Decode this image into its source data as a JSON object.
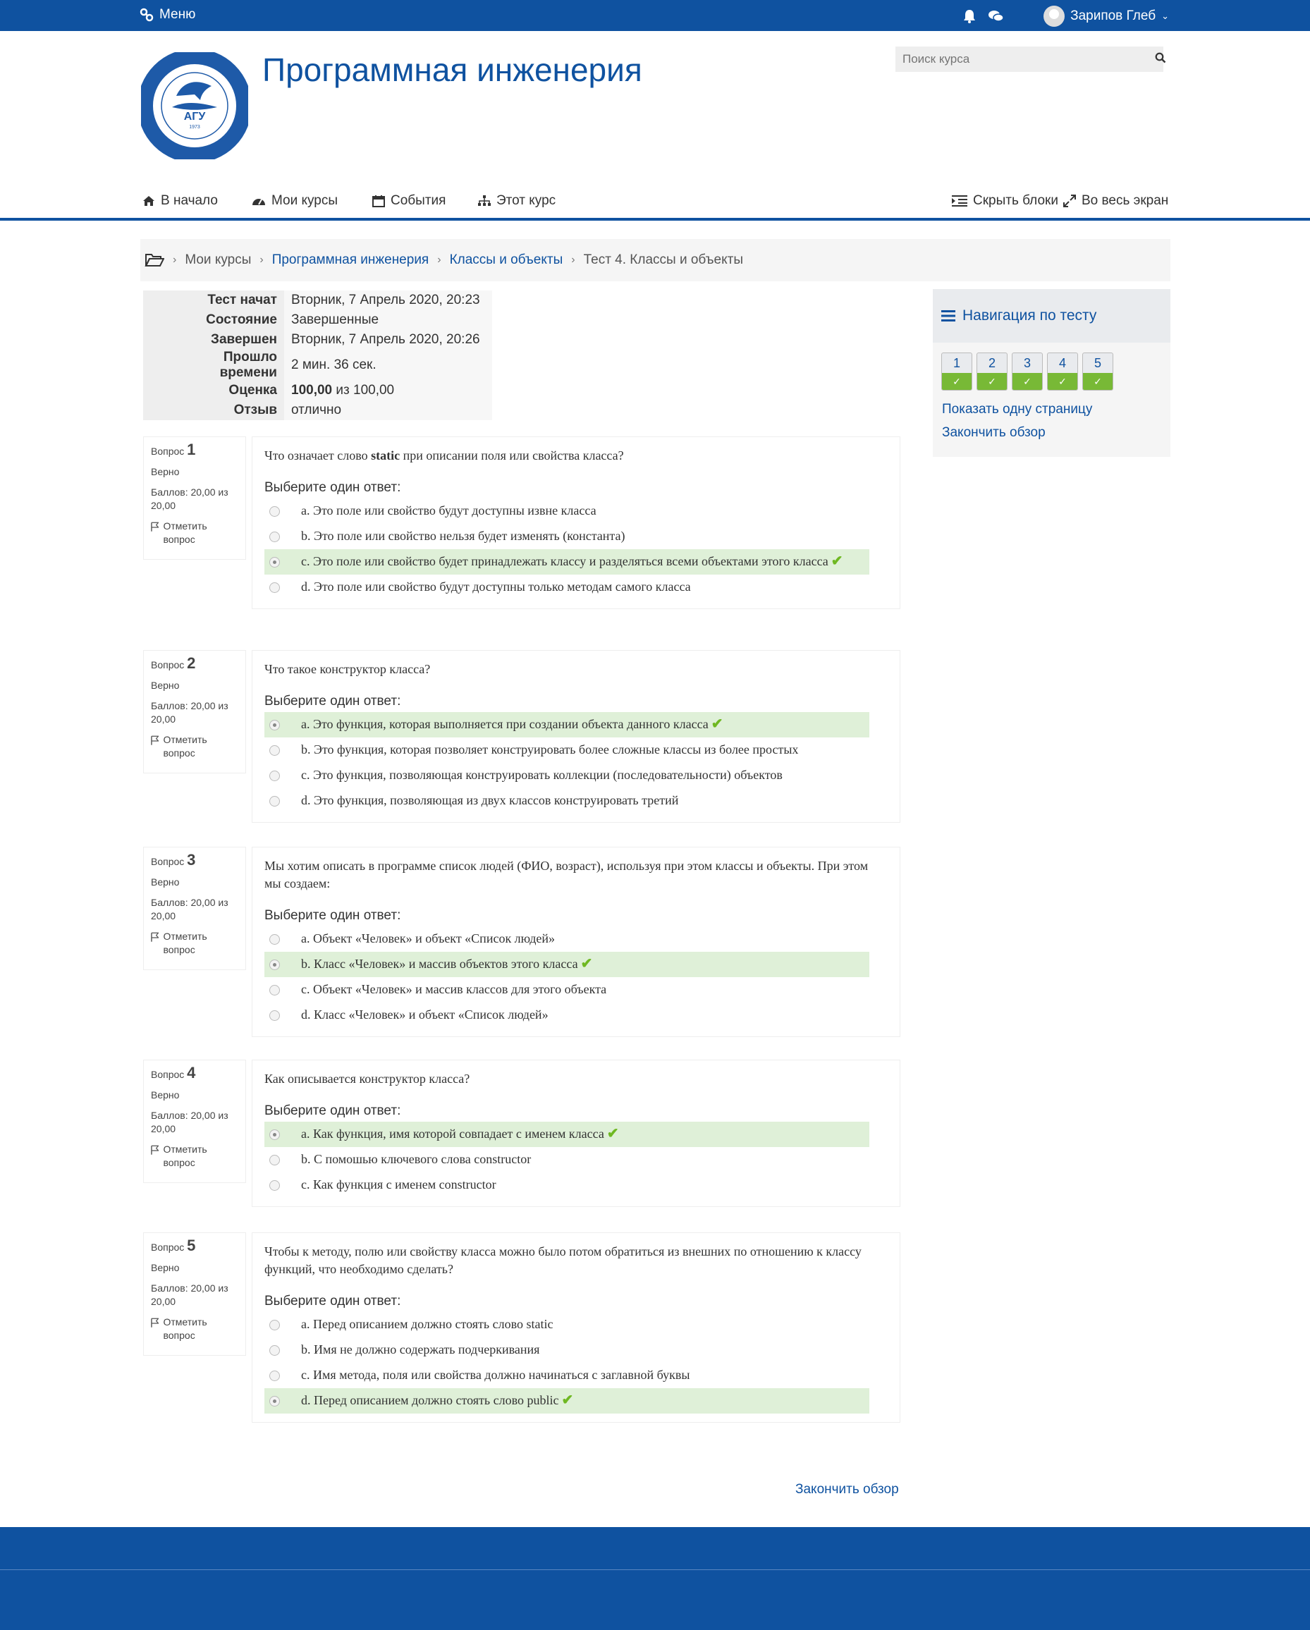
{
  "topbar": {
    "menu_label": "Меню",
    "user_name": "Зарипов Глеб"
  },
  "header": {
    "site_title": "Программная инженерия",
    "search_placeholder": "Поиск курса",
    "logo_text": [
      "АЛТАЙСКИЙ ГОСУДАРСТВЕННЫЙ УНИВЕРСИТЕТ",
      "АГУ",
      "1973"
    ]
  },
  "nav": {
    "home": "В начало",
    "my_courses": "Мои курсы",
    "events": "События",
    "this_course": "Этот курс",
    "hide_blocks": "Скрыть блоки",
    "fullscreen": "Во весь экран"
  },
  "breadcrumb": [
    "Мои курсы",
    "Программная инженерия",
    "Классы и объекты",
    "Тест 4. Классы и объекты"
  ],
  "summary": [
    {
      "label": "Тест начат",
      "value": "Вторник, 7 Апрель 2020, 20:23"
    },
    {
      "label": "Состояние",
      "value": "Завершенные"
    },
    {
      "label": "Завершен",
      "value": "Вторник, 7 Апрель 2020, 20:26"
    },
    {
      "label": "Прошло времени",
      "value": "2 мин. 36 сек."
    },
    {
      "label": "Оценка",
      "value_bold": "100,00",
      "value": " из 100,00"
    },
    {
      "label": "Отзыв",
      "value": "отлично"
    }
  ],
  "question_labels": {
    "question": "Вопрос",
    "status": "Верно",
    "score": "Баллов: 20,00 из 20,00",
    "flag": "Отметить вопрос",
    "prompt": "Выберите один ответ:"
  },
  "questions": [
    {
      "number": "1",
      "text_before": "Что означает слово ",
      "text_bold": "static",
      "text_after": " при описании поля или свойства класса?",
      "answers": [
        "a. Это поле или свойство будут доступны извне класса",
        "b. Это поле или свойство нельзя будет изменять (константа)",
        "c. Это поле или свойство будет принадлежать классу и разделяться всеми объектами этого класса",
        "d. Это поле или свойство будут доступны только методам самого класса"
      ],
      "selected": 2
    },
    {
      "number": "2",
      "text": "Что такое конструктор класса?",
      "answers": [
        "a. Это функция, которая выполняется при создании объекта данного класса",
        "b. Это функция, которая позволяет конструировать более сложные классы из более простых",
        "c. Это функция, позволяющая конструировать коллекции (последовательности) объектов",
        "d. Это функция, позволяющая из двух классов конструировать третий"
      ],
      "selected": 0
    },
    {
      "number": "3",
      "text": "Мы хотим описать в программе список людей (ФИО, возраст), используя при этом классы и объекты. При этом мы создаем:",
      "answers": [
        "a. Объект «Человек» и объект «Список людей»",
        "b. Класс «Человек» и массив объектов этого класса",
        "c. Объект «Человек» и массив классов для этого объекта",
        "d. Класс «Человек» и объект «Список людей»"
      ],
      "selected": 1
    },
    {
      "number": "4",
      "text": "Как описывается конструктор класса?",
      "answers": [
        "a. Как функция, имя которой совпадает с именем класса",
        "b. С помошью ключевого слова constructor",
        "c. Как функция с именем constructor"
      ],
      "selected": 0
    },
    {
      "number": "5",
      "text": "Чтобы к методу, полю или свойству класса можно было потом обратиться из внешних по отношению к классу функций, что необходимо сделать?",
      "answers": [
        "a. Перед описанием должно стоять слово static",
        "b. Имя не должно содержать подчеркивания",
        "c. Имя метода, поля или свойства должно начинаться с заглавной буквы",
        "d. Перед описанием должно стоять слово public"
      ],
      "selected": 3
    }
  ],
  "quiz_nav": {
    "title": "Навигация по тесту",
    "buttons": [
      "1",
      "2",
      "3",
      "4",
      "5"
    ],
    "show_one_page": "Показать одну страницу",
    "finish_review": "Закончить обзор"
  },
  "finish_review": "Закончить обзор",
  "colors": {
    "brand": "#0f52a0",
    "correct_bg": "#dff0d8",
    "check": "#6fb822"
  }
}
